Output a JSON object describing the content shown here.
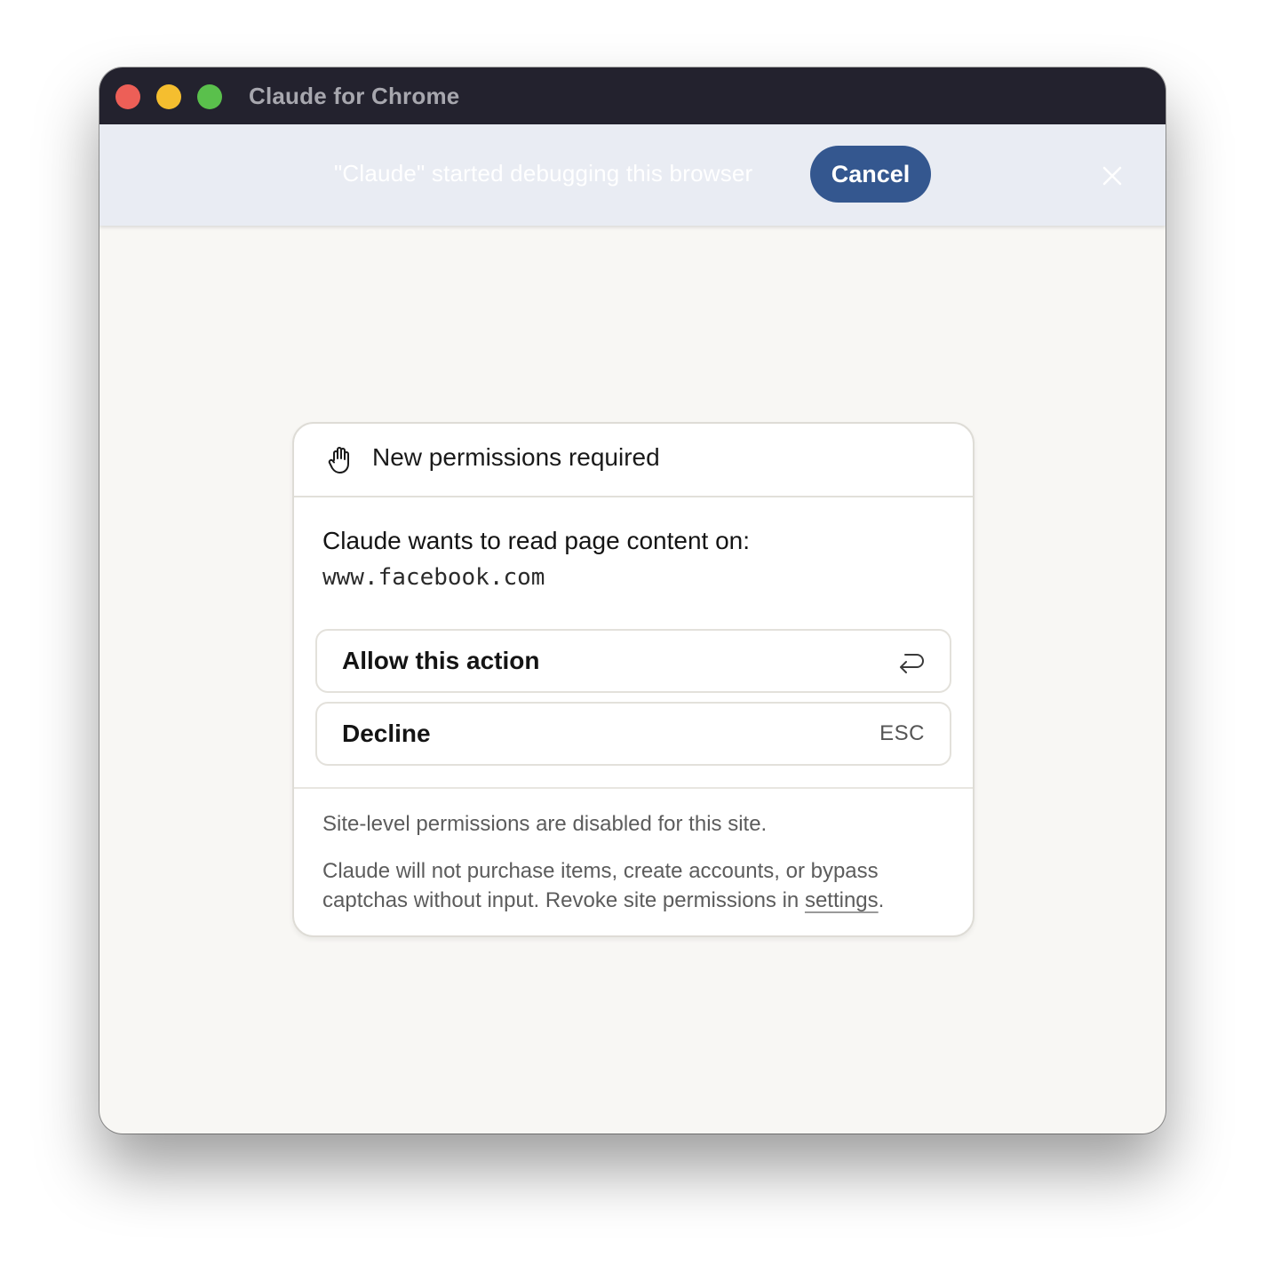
{
  "window": {
    "title": "Claude for Chrome"
  },
  "debug_bar": {
    "message": "\"Claude\" started debugging this browser",
    "cancel_label": "Cancel"
  },
  "permission_dialog": {
    "header_icon": "hand-icon",
    "title": "New permissions required",
    "request_text": "Claude wants to read page content on:",
    "domain": "www.facebook.com",
    "options": {
      "allow": {
        "label": "Allow this action",
        "shortcut_icon": "enter-key-icon"
      },
      "decline": {
        "label": "Decline",
        "shortcut": "ESC"
      }
    },
    "footer": {
      "site_level_note": "Site-level permissions are disabled for this site.",
      "disclaimer_before_link": "Claude will not purchase items, create accounts, or bypass captchas without input. Revoke site permissions in ",
      "settings_link": "settings",
      "disclaimer_after_link": "."
    }
  },
  "colors": {
    "titlebar": "#23222e",
    "debug_bar": "#e9ecf3",
    "cancel_button": "#34578f",
    "page_background": "#f8f7f4",
    "traffic_close": "#ed5f57",
    "traffic_minimize": "#f5be2f",
    "traffic_maximize": "#5ac04c"
  }
}
